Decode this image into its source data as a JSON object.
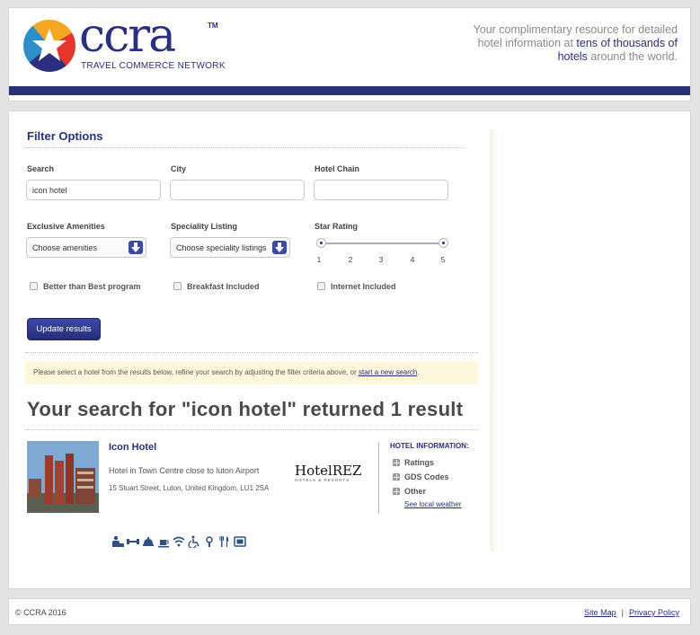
{
  "header": {
    "brand": "ccra",
    "trademark": "TM",
    "brand_subtitle": "TRAVEL COMMERCE NETWORK",
    "tagline_pre": "Your complimentary resource for detailed hotel information at ",
    "tagline_highlight": "tens of thousands of hotels",
    "tagline_post": " around the world.",
    "brand_color": "#2b2f7a"
  },
  "filters": {
    "title": "Filter Options",
    "search_label": "Search",
    "search_value": "icon hotel",
    "city_label": "City",
    "city_value": "",
    "chain_label": "Hotel Chain",
    "chain_value": "",
    "amenities_label": "Exclusive Amenities",
    "amenities_value": "Choose amenities",
    "speciality_label": "Speciality Listing",
    "speciality_value": "Choose speciality listings",
    "star_label": "Star Rating",
    "star_ticks": [
      "1",
      "2",
      "3",
      "4",
      "5"
    ],
    "star_range": [
      1,
      5
    ],
    "checkbox_1": "Better than Best program",
    "checkbox_2": "Breakfast Included",
    "checkbox_3": "Internet Included",
    "update_button": "Update results"
  },
  "notice": {
    "text": "Please select a hotel from the results below, refine your search by adjusting the filter criteria above, or ",
    "link": "start a new search",
    "end": "."
  },
  "results": {
    "heading": "Your search for \"icon hotel\" returned 1 result",
    "hotels": [
      {
        "name": "Icon Hotel",
        "description": "Hotel in Town Centre close to luton Airport",
        "address": "15 Stuart Street, Luton, United Kingdom, LU1 2SA",
        "chain_logo": "HotelREZ",
        "chain_logo_sub": "HOTELS & RESORTS",
        "info_title": "HOTEL INFORMATION:",
        "info_items": [
          "Ratings",
          "GDS Codes",
          "Other"
        ],
        "weather_link": "See local weather",
        "amenity_icons": [
          "business-centre-icon",
          "fitness-icon",
          "room-service-icon",
          "breakfast-icon",
          "wifi-icon",
          "accessible-icon",
          "meeting-icon",
          "restaurant-icon",
          "tv-icon"
        ]
      }
    ]
  },
  "footer": {
    "copyright": "© CCRA 2016",
    "site_map": "Site Map",
    "separator": "|",
    "privacy": "Privacy Policy"
  }
}
